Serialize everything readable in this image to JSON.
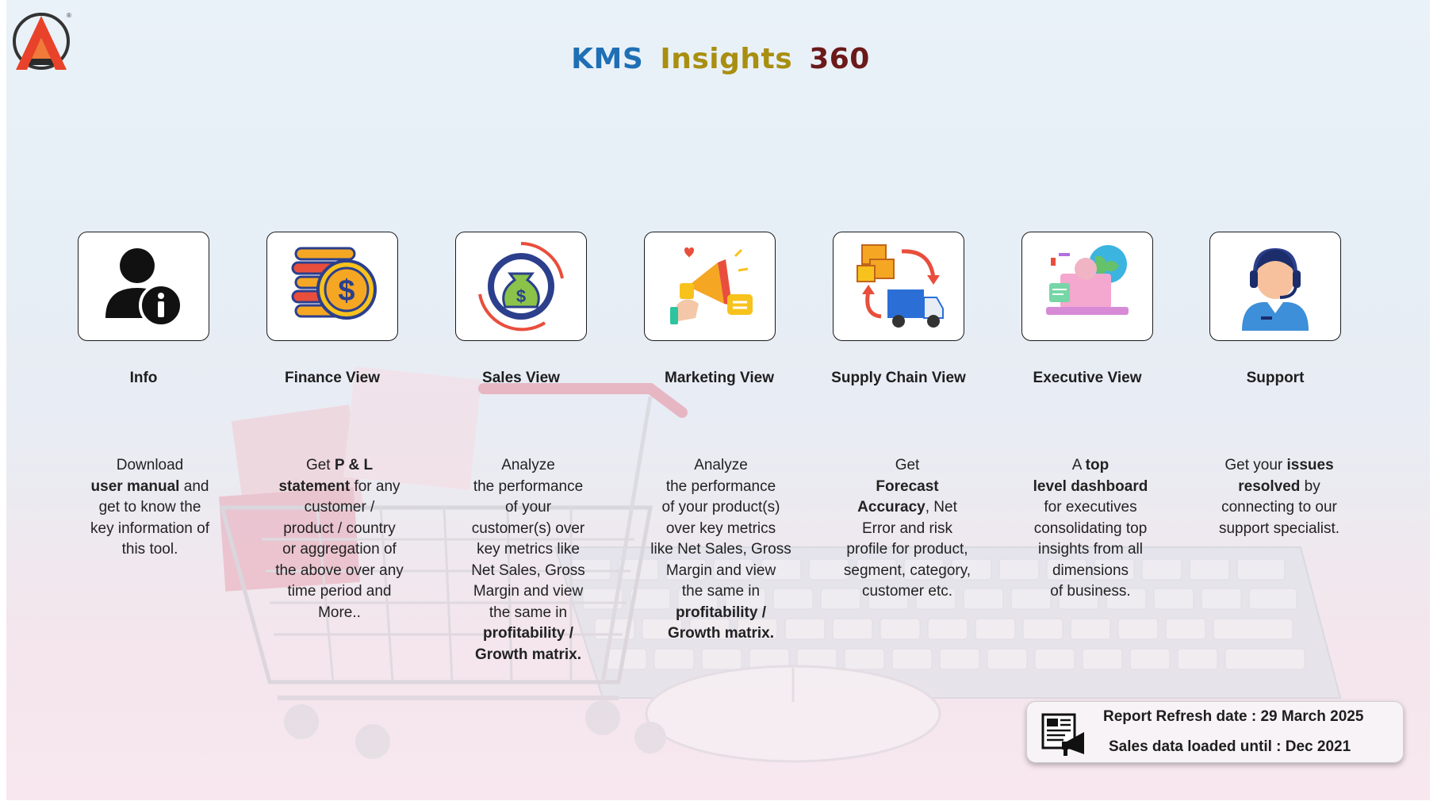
{
  "app": {
    "title_parts": [
      {
        "text": "KMS",
        "color": "#1f6fb5"
      },
      {
        "text": "Insights",
        "color": "#a88f10"
      },
      {
        "text": "360",
        "color": "#6b1a1a"
      }
    ]
  },
  "cards": [
    {
      "label": "Info",
      "icon": "user-info-icon",
      "desc": [
        "Download",
        "<b>user manual</b> and",
        "get to know the",
        "key information of",
        "this tool."
      ]
    },
    {
      "label": "Finance View",
      "icon": "coins-dollar-icon",
      "desc": [
        "Get  <b>P &amp; L</b>",
        "<b>statement</b> for any",
        "customer /",
        "product / country",
        "or aggregation of",
        "the above over any",
        "time period and",
        "More.."
      ]
    },
    {
      "label": "Sales View",
      "icon": "money-bag-cycle-icon",
      "desc": [
        "Analyze",
        "the performance",
        "of your",
        "customer(s) over",
        "key metrics like",
        "Net Sales, Gross",
        "Margin and view",
        "the same in",
        "<b>profitability /</b>",
        "<b>Growth matrix.</b>"
      ]
    },
    {
      "label": "Marketing View",
      "icon": "megaphone-icon",
      "desc": [
        "Analyze",
        "the performance",
        "of your product(s)",
        "over key metrics",
        "like Net Sales, Gross",
        "Margin and view",
        "the same in",
        "<b>profitability /</b>",
        "<b>Growth matrix.</b>"
      ]
    },
    {
      "label": "Supply Chain View",
      "icon": "boxes-truck-icon",
      "desc": [
        "Get",
        "<b>Forecast</b>",
        "<b>Accuracy</b>, Net",
        "Error and risk",
        "profile for product,",
        "segment, category,",
        "customer etc."
      ]
    },
    {
      "label": "Executive View",
      "icon": "executive-dashboard-icon",
      "desc": [
        "A <b>top</b>",
        "<b>level dashboard</b>",
        "for executives",
        "consolidating top",
        "insights from all",
        "dimensions",
        "of business."
      ]
    },
    {
      "label": "Support",
      "icon": "support-agent-icon",
      "desc": [
        "Get your <b>issues</b>",
        "<b>resolved</b> by",
        "connecting to our",
        "support specialist."
      ]
    }
  ],
  "report": {
    "refresh": "Report Refresh date : 29 March 2025",
    "loaded": "Sales data loaded until : Dec 2021",
    "icon": "newspaper-megaphone-icon"
  }
}
